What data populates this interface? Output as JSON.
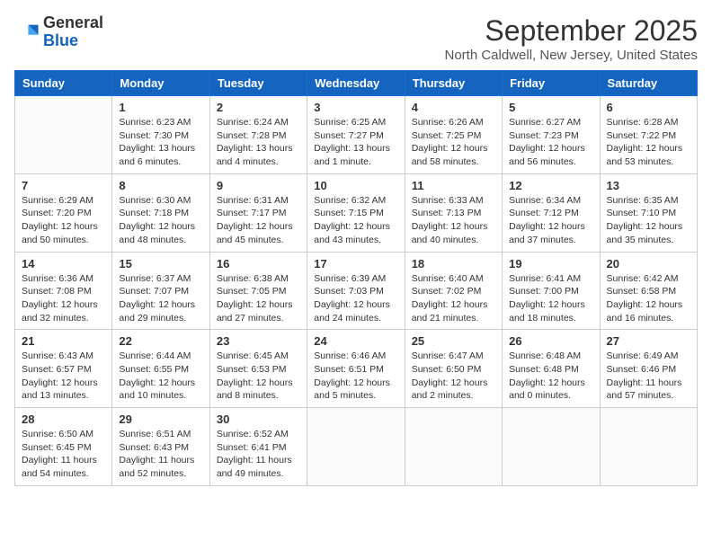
{
  "header": {
    "logo_line1": "General",
    "logo_line2": "Blue",
    "month": "September 2025",
    "location": "North Caldwell, New Jersey, United States"
  },
  "weekdays": [
    "Sunday",
    "Monday",
    "Tuesday",
    "Wednesday",
    "Thursday",
    "Friday",
    "Saturday"
  ],
  "weeks": [
    [
      {
        "day": "",
        "info": ""
      },
      {
        "day": "1",
        "info": "Sunrise: 6:23 AM\nSunset: 7:30 PM\nDaylight: 13 hours\nand 6 minutes."
      },
      {
        "day": "2",
        "info": "Sunrise: 6:24 AM\nSunset: 7:28 PM\nDaylight: 13 hours\nand 4 minutes."
      },
      {
        "day": "3",
        "info": "Sunrise: 6:25 AM\nSunset: 7:27 PM\nDaylight: 13 hours\nand 1 minute."
      },
      {
        "day": "4",
        "info": "Sunrise: 6:26 AM\nSunset: 7:25 PM\nDaylight: 12 hours\nand 58 minutes."
      },
      {
        "day": "5",
        "info": "Sunrise: 6:27 AM\nSunset: 7:23 PM\nDaylight: 12 hours\nand 56 minutes."
      },
      {
        "day": "6",
        "info": "Sunrise: 6:28 AM\nSunset: 7:22 PM\nDaylight: 12 hours\nand 53 minutes."
      }
    ],
    [
      {
        "day": "7",
        "info": "Sunrise: 6:29 AM\nSunset: 7:20 PM\nDaylight: 12 hours\nand 50 minutes."
      },
      {
        "day": "8",
        "info": "Sunrise: 6:30 AM\nSunset: 7:18 PM\nDaylight: 12 hours\nand 48 minutes."
      },
      {
        "day": "9",
        "info": "Sunrise: 6:31 AM\nSunset: 7:17 PM\nDaylight: 12 hours\nand 45 minutes."
      },
      {
        "day": "10",
        "info": "Sunrise: 6:32 AM\nSunset: 7:15 PM\nDaylight: 12 hours\nand 43 minutes."
      },
      {
        "day": "11",
        "info": "Sunrise: 6:33 AM\nSunset: 7:13 PM\nDaylight: 12 hours\nand 40 minutes."
      },
      {
        "day": "12",
        "info": "Sunrise: 6:34 AM\nSunset: 7:12 PM\nDaylight: 12 hours\nand 37 minutes."
      },
      {
        "day": "13",
        "info": "Sunrise: 6:35 AM\nSunset: 7:10 PM\nDaylight: 12 hours\nand 35 minutes."
      }
    ],
    [
      {
        "day": "14",
        "info": "Sunrise: 6:36 AM\nSunset: 7:08 PM\nDaylight: 12 hours\nand 32 minutes."
      },
      {
        "day": "15",
        "info": "Sunrise: 6:37 AM\nSunset: 7:07 PM\nDaylight: 12 hours\nand 29 minutes."
      },
      {
        "day": "16",
        "info": "Sunrise: 6:38 AM\nSunset: 7:05 PM\nDaylight: 12 hours\nand 27 minutes."
      },
      {
        "day": "17",
        "info": "Sunrise: 6:39 AM\nSunset: 7:03 PM\nDaylight: 12 hours\nand 24 minutes."
      },
      {
        "day": "18",
        "info": "Sunrise: 6:40 AM\nSunset: 7:02 PM\nDaylight: 12 hours\nand 21 minutes."
      },
      {
        "day": "19",
        "info": "Sunrise: 6:41 AM\nSunset: 7:00 PM\nDaylight: 12 hours\nand 18 minutes."
      },
      {
        "day": "20",
        "info": "Sunrise: 6:42 AM\nSunset: 6:58 PM\nDaylight: 12 hours\nand 16 minutes."
      }
    ],
    [
      {
        "day": "21",
        "info": "Sunrise: 6:43 AM\nSunset: 6:57 PM\nDaylight: 12 hours\nand 13 minutes."
      },
      {
        "day": "22",
        "info": "Sunrise: 6:44 AM\nSunset: 6:55 PM\nDaylight: 12 hours\nand 10 minutes."
      },
      {
        "day": "23",
        "info": "Sunrise: 6:45 AM\nSunset: 6:53 PM\nDaylight: 12 hours\nand 8 minutes."
      },
      {
        "day": "24",
        "info": "Sunrise: 6:46 AM\nSunset: 6:51 PM\nDaylight: 12 hours\nand 5 minutes."
      },
      {
        "day": "25",
        "info": "Sunrise: 6:47 AM\nSunset: 6:50 PM\nDaylight: 12 hours\nand 2 minutes."
      },
      {
        "day": "26",
        "info": "Sunrise: 6:48 AM\nSunset: 6:48 PM\nDaylight: 12 hours\nand 0 minutes."
      },
      {
        "day": "27",
        "info": "Sunrise: 6:49 AM\nSunset: 6:46 PM\nDaylight: 11 hours\nand 57 minutes."
      }
    ],
    [
      {
        "day": "28",
        "info": "Sunrise: 6:50 AM\nSunset: 6:45 PM\nDaylight: 11 hours\nand 54 minutes."
      },
      {
        "day": "29",
        "info": "Sunrise: 6:51 AM\nSunset: 6:43 PM\nDaylight: 11 hours\nand 52 minutes."
      },
      {
        "day": "30",
        "info": "Sunrise: 6:52 AM\nSunset: 6:41 PM\nDaylight: 11 hours\nand 49 minutes."
      },
      {
        "day": "",
        "info": ""
      },
      {
        "day": "",
        "info": ""
      },
      {
        "day": "",
        "info": ""
      },
      {
        "day": "",
        "info": ""
      }
    ]
  ]
}
